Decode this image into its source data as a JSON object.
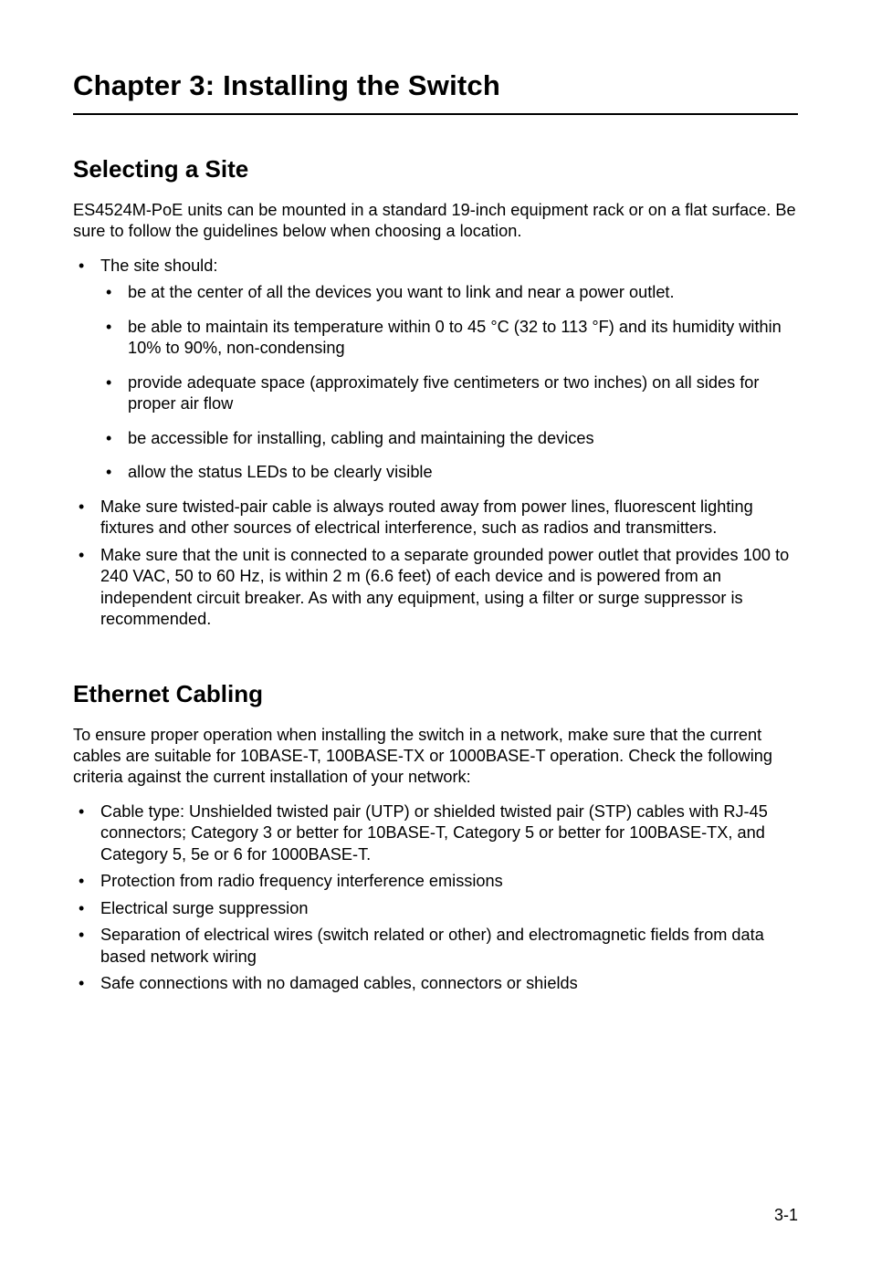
{
  "chapter_title": "Chapter 3: Installing the Switch",
  "sections": {
    "selecting_site": {
      "title": "Selecting a Site",
      "intro": "ES4524M-PoE units can be mounted in a standard 19-inch equipment rack or on a flat surface. Be sure to follow the guidelines below when choosing a location.",
      "list1_item1": "The site should:",
      "sub_items": [
        "be at the center of all the devices you want to link and near a power outlet.",
        "be able to maintain its temperature within 0 to 45 °C (32 to 113 °F) and its humidity within 10% to 90%, non-condensing",
        "provide adequate space (approximately five centimeters or two inches) on all sides for proper air flow",
        "be accessible for installing, cabling and maintaining the devices",
        "allow the status LEDs to be clearly visible"
      ],
      "list1_item2": "Make sure twisted-pair cable is always routed away from power lines, fluorescent lighting fixtures and other sources of electrical interference, such as radios and transmitters.",
      "list1_item3": "Make sure that the unit is connected to a separate grounded power outlet that provides 100 to 240 VAC, 50 to 60 Hz, is within 2 m (6.6 feet) of each device and is powered from an independent circuit breaker. As with any equipment, using a filter or surge suppressor is recommended."
    },
    "ethernet_cabling": {
      "title": "Ethernet Cabling",
      "intro": "To ensure proper operation when installing the switch in a network, make sure that the current cables are suitable for 10BASE-T, 100BASE-TX or 1000BASE-T operation. Check the following criteria against the current installation of your network:",
      "items": [
        "Cable type: Unshielded twisted pair (UTP) or shielded twisted pair (STP) cables with RJ-45 connectors; Category 3 or better for 10BASE-T, Category 5 or better for 100BASE-TX, and Category 5, 5e or 6 for 1000BASE-T.",
        "Protection from radio frequency interference emissions",
        "Electrical surge suppression",
        "Separation of electrical wires (switch related or other) and electromagnetic fields from data based network wiring",
        "Safe connections with no damaged cables, connectors or shields"
      ]
    }
  },
  "page_number": "3-1"
}
